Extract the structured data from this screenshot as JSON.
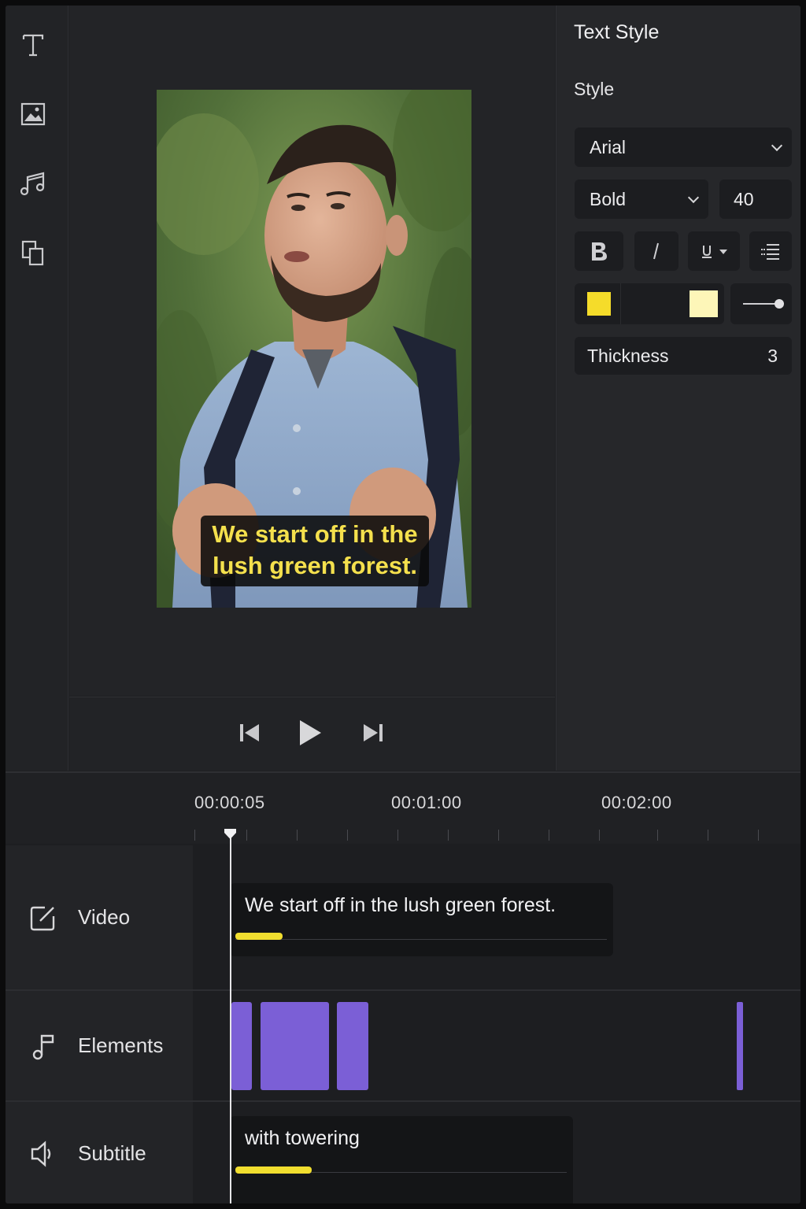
{
  "rail": {
    "tools": [
      {
        "name": "text-tool",
        "icon": "text-icon"
      },
      {
        "name": "image-tool",
        "icon": "image-icon"
      },
      {
        "name": "music-tool",
        "icon": "music-icon"
      },
      {
        "name": "layers-tool",
        "icon": "layers-icon"
      }
    ]
  },
  "preview": {
    "caption_line1": "We start off in the",
    "caption_line2": "lush green forest.",
    "caption_color": "#f4e04d"
  },
  "playback": {
    "prev_icon": "skip-back-icon",
    "play_icon": "play-icon",
    "next_icon": "skip-forward-icon"
  },
  "panel": {
    "title": "Text Style",
    "style_label": "Style",
    "font": "Arial",
    "weight": "Bold",
    "size": "40",
    "format_icons": [
      "bold-icon",
      "italic-icon",
      "underline-icon",
      "list-icon"
    ],
    "fill_color": "#f5dc2a",
    "outline_color": "#fdf6b8",
    "thickness_label": "Thickness",
    "thickness_value": "3"
  },
  "timeline": {
    "timecodes": [
      "00:00:05",
      "00:01:00",
      "00:02:00"
    ],
    "tracks": [
      {
        "label": "Video",
        "icon": "edit-square-icon"
      },
      {
        "label": "Elements",
        "icon": "music-note-icon"
      },
      {
        "label": "Subtitle",
        "icon": "speaker-icon"
      }
    ],
    "video_clip_text": "We start off in the lush green forest.",
    "subtitle_clip_text": "with towering",
    "element_color": "#7b5fd6",
    "bar_color": "#f1de2f"
  }
}
